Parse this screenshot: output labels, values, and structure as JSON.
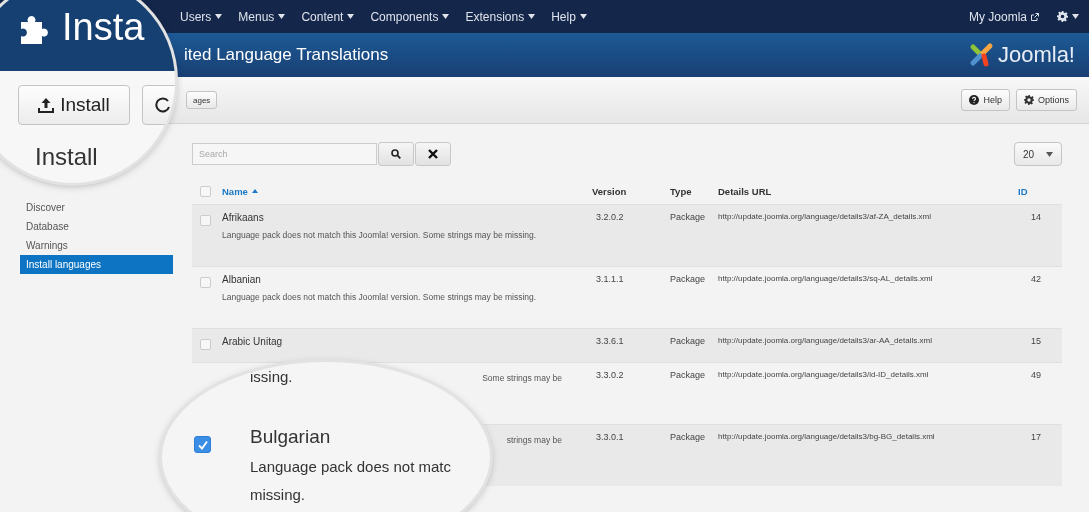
{
  "top_nav": {
    "menus": [
      {
        "label": "Users"
      },
      {
        "label": "Menus"
      },
      {
        "label": "Content"
      },
      {
        "label": "Components"
      },
      {
        "label": "Extensions"
      },
      {
        "label": "Help"
      }
    ],
    "site_link": "My Joomla"
  },
  "header": {
    "title": "ited Language Translations",
    "logo": "Joomla!"
  },
  "toolbar": {
    "left_button": "ages",
    "right_buttons": [
      {
        "label": "Help"
      },
      {
        "label": "Options"
      }
    ]
  },
  "sidebar": {
    "items": [
      {
        "label": "Discover",
        "selected": false
      },
      {
        "label": "Database",
        "selected": false
      },
      {
        "label": "Warnings",
        "selected": false
      },
      {
        "label": "Install languages",
        "selected": true
      }
    ]
  },
  "filters": {
    "search": {
      "placeholder": "Search"
    },
    "limit": "20"
  },
  "table": {
    "select_all": {
      "checked": false
    },
    "columns": [
      {
        "label": "Name",
        "kind": "link",
        "sorted": true
      },
      {
        "label": "Version",
        "kind": "plain",
        "sorted": false
      },
      {
        "label": "Type",
        "kind": "plain",
        "sorted": false
      },
      {
        "label": "Details URL",
        "kind": "plain",
        "sorted": false
      },
      {
        "label": "ID",
        "kind": "link",
        "sorted": false
      }
    ],
    "rows": [
      {
        "checked": false,
        "name": "Afrikaans",
        "description": "Language pack does not match this Joomla! version. Some strings may be missing.",
        "version": "3.2.0.2",
        "type": "Package",
        "url": "http://update.joomla.org/language/details3/af-ZA_details.xml",
        "id": "14"
      },
      {
        "checked": false,
        "name": "Albanian",
        "description": "Language pack does not match this Joomla! version. Some strings may be missing.",
        "version": "3.1.1.1",
        "type": "Package",
        "url": "http://update.joomla.org/language/details3/sq-AL_details.xml",
        "id": "42"
      },
      {
        "checked": false,
        "name": "Arabic Unitag",
        "version": "3.3.6.1",
        "type": "Package",
        "url": "http://update.joomla.org/language/details3/ar-AA_details.xml",
        "id": "15"
      },
      {
        "description_fragment": "Some strings may be",
        "version": "3.3.0.2",
        "type": "Package",
        "url": "http://update.joomla.org/language/details3/id-ID_details.xml",
        "id": "49"
      },
      {
        "description_fragment": "strings may be",
        "version": "3.3.0.1",
        "type": "Package",
        "url": "http://update.joomla.org/language/details3/bg-BG_details.xml",
        "id": "17"
      }
    ]
  },
  "magnifiers": [
    {
      "kind": "header",
      "title": "Insta",
      "button": "Install",
      "heading": "Install"
    },
    {
      "kind": "row",
      "top_text": "issing.",
      "checked": true,
      "name": "Bulgarian",
      "description": "Language pack does not matc",
      "description_2": "missing."
    }
  ]
}
